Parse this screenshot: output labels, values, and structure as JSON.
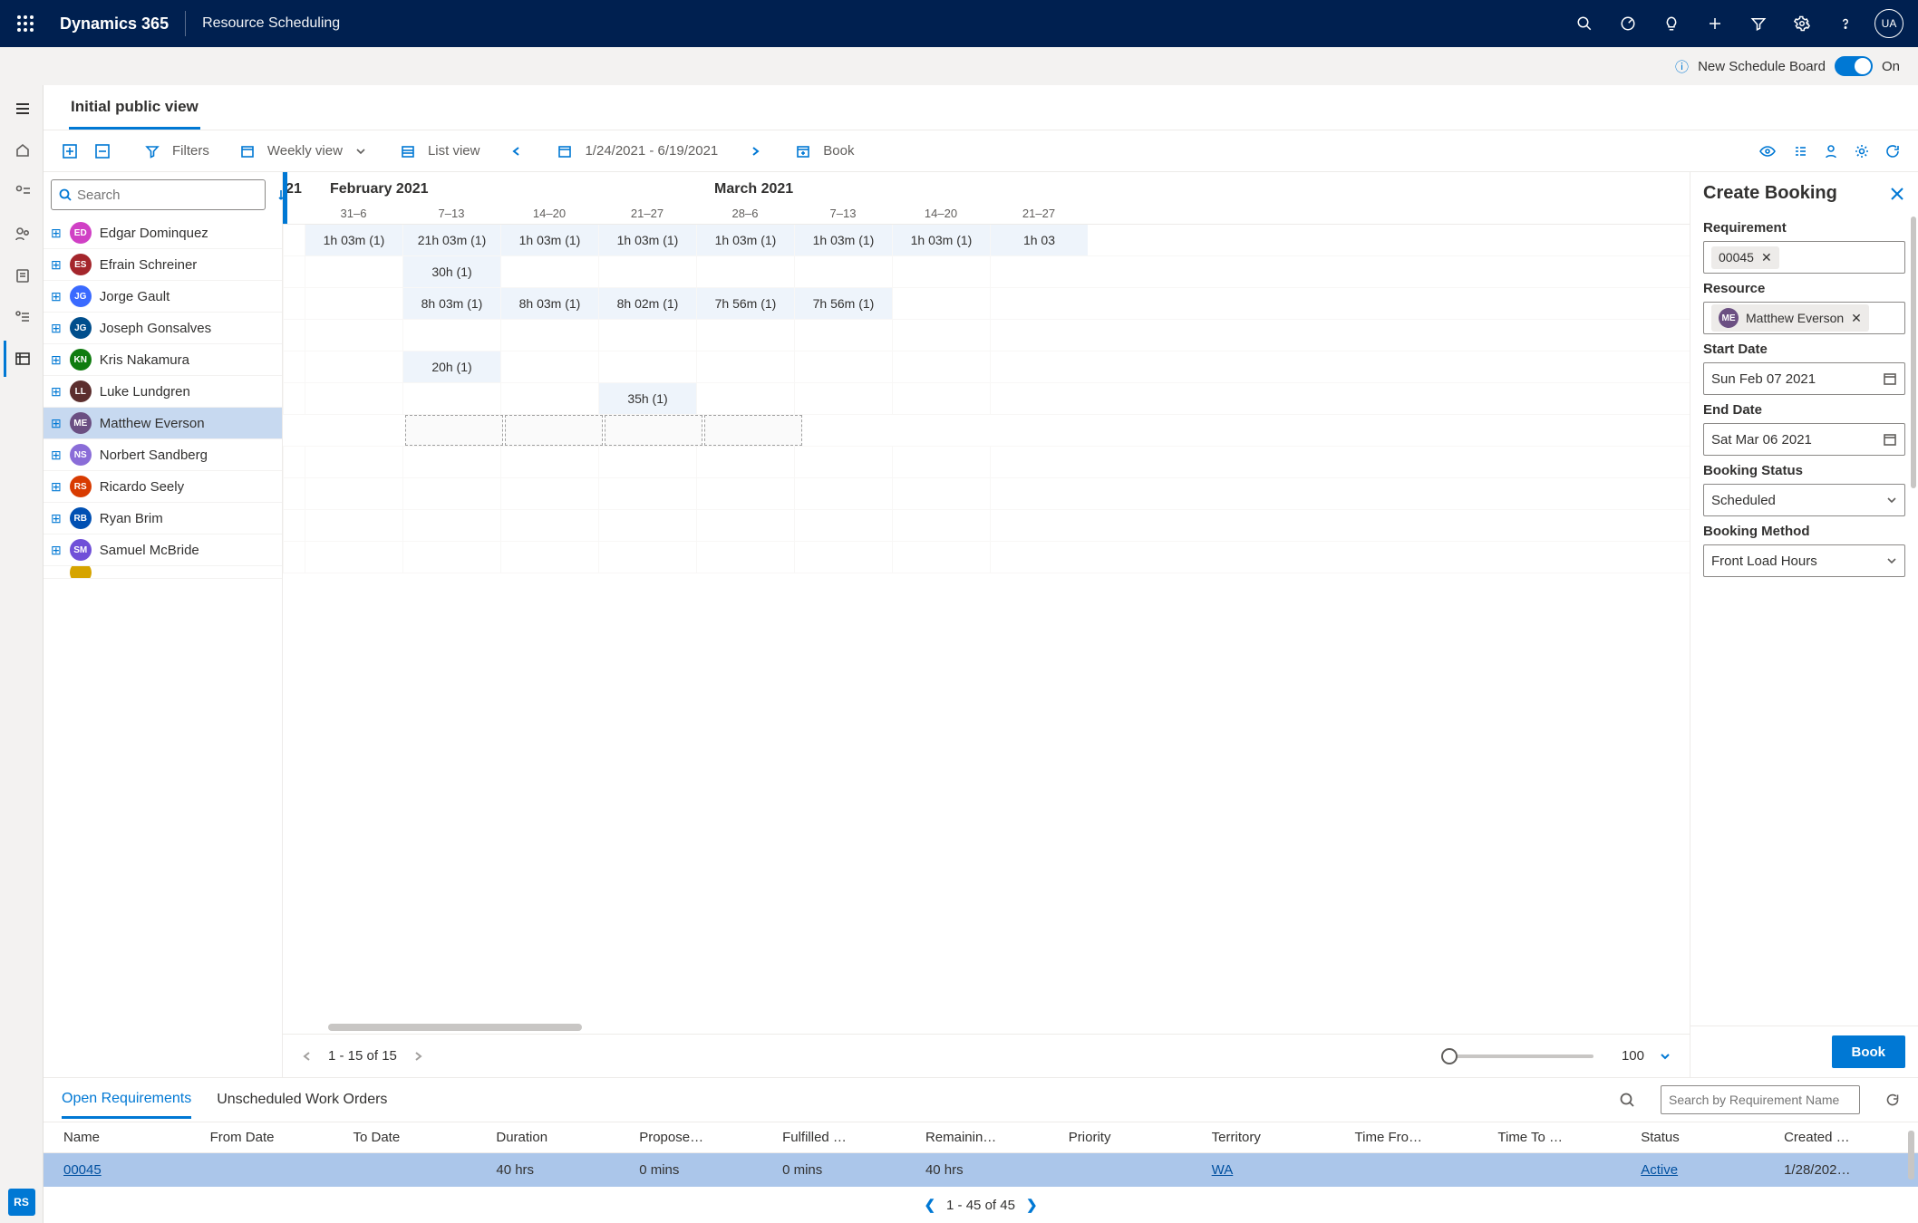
{
  "top": {
    "brand": "Dynamics 365",
    "subtitle": "Resource Scheduling",
    "avatar": "UA"
  },
  "toggle": {
    "label": "New Schedule Board",
    "state": "On"
  },
  "tab": "Initial public view",
  "toolbar": {
    "filters": "Filters",
    "view": "Weekly view",
    "list": "List view",
    "range": "1/24/2021 - 6/19/2021",
    "book": "Book"
  },
  "search_placeholder": "Search",
  "month_prefix": "21",
  "months": [
    "February 2021",
    "March 2021"
  ],
  "weeks": [
    "31–6",
    "7–13",
    "14–20",
    "21–27",
    "28–6",
    "7–13",
    "14–20",
    "21–27"
  ],
  "resources": [
    {
      "initials": "ED",
      "name": "Edgar Dominquez",
      "color": "#d040c5",
      "selected": false
    },
    {
      "initials": "ES",
      "name": "Efrain Schreiner",
      "color": "#a4262c",
      "selected": false
    },
    {
      "initials": "JG",
      "name": "Jorge Gault",
      "color": "#3a6aff",
      "selected": false
    },
    {
      "initials": "JG",
      "name": "Joseph Gonsalves",
      "color": "#004e8c",
      "selected": false
    },
    {
      "initials": "KN",
      "name": "Kris Nakamura",
      "color": "#107c10",
      "selected": false
    },
    {
      "initials": "LL",
      "name": "Luke Lundgren",
      "color": "#5c2e2e",
      "selected": false
    },
    {
      "initials": "ME",
      "name": "Matthew Everson",
      "color": "#6b4f82",
      "selected": true
    },
    {
      "initials": "NS",
      "name": "Norbert Sandberg",
      "color": "#8a6dd8",
      "selected": false
    },
    {
      "initials": "RS",
      "name": "Ricardo Seely",
      "color": "#d83b01",
      "selected": false
    },
    {
      "initials": "RB",
      "name": "Ryan Brim",
      "color": "#0050b3",
      "selected": false
    },
    {
      "initials": "SM",
      "name": "Samuel McBride",
      "color": "#7050d8",
      "selected": false
    }
  ],
  "bookings": {
    "0": {
      "0": "1h 03m (1)",
      "1": "21h 03m (1)",
      "2": "1h 03m (1)",
      "3": "1h 03m (1)",
      "4": "1h 03m (1)",
      "5": "1h 03m (1)",
      "6": "1h 03m (1)",
      "7": "1h 03"
    },
    "1": {
      "1": "30h (1)"
    },
    "2": {
      "1": "8h 03m (1)",
      "2": "8h 03m (1)",
      "3": "8h 02m (1)",
      "4": "7h 56m (1)",
      "5": "7h 56m (1)"
    },
    "4": {
      "1": "20h (1)"
    },
    "5": {
      "3": "35h (1)"
    }
  },
  "dashed_row": 6,
  "pager": {
    "text": "1 - 15 of 15",
    "slider_value": "100"
  },
  "panel": {
    "title": "Create Booking",
    "labels": {
      "req": "Requirement",
      "res": "Resource",
      "sd": "Start Date",
      "ed": "End Date",
      "bs": "Booking Status",
      "bm": "Booking Method"
    },
    "requirement": "00045",
    "resource_name": "Matthew Everson",
    "resource_initials": "ME",
    "start_date": "Sun Feb 07 2021",
    "end_date": "Sat Mar 06 2021",
    "booking_status": "Scheduled",
    "booking_method": "Front Load Hours",
    "book_btn": "Book"
  },
  "bottom": {
    "tabs": [
      "Open Requirements",
      "Unscheduled Work Orders"
    ],
    "search_placeholder": "Search by Requirement Name",
    "columns": [
      "Name",
      "From Date",
      "To Date",
      "Duration",
      "Propose…",
      "Fulfilled …",
      "Remainin…",
      "Priority",
      "Territory",
      "Time Fro…",
      "Time To …",
      "Status",
      "Created …"
    ],
    "row": {
      "name": "00045",
      "from": "",
      "to": "",
      "duration": "40 hrs",
      "propose": "0 mins",
      "fulfilled": "0 mins",
      "remain": "40 hrs",
      "priority": "",
      "territory": "WA",
      "tfrom": "",
      "tto": "",
      "status": "Active",
      "created": "1/28/202…"
    },
    "pager": "1 - 45 of 45"
  },
  "nav_chip": "RS"
}
